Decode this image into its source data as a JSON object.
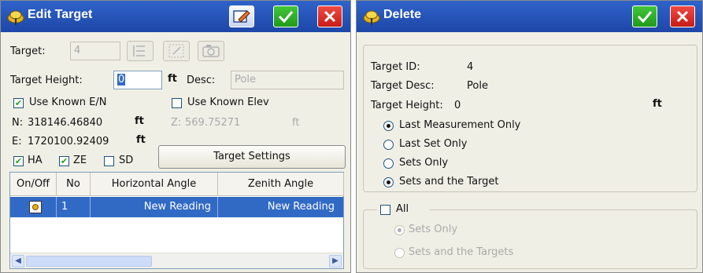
{
  "left_window": {
    "title": "Edit Target",
    "target": {
      "label": "Target:",
      "value": "4"
    },
    "target_height": {
      "label": "Target Height:",
      "value": "0",
      "unit": "ft"
    },
    "desc": {
      "label": "Desc:",
      "value": "Pole"
    },
    "use_known_en": {
      "label": "Use Known E/N",
      "checked": true
    },
    "use_known_elev": {
      "label": "Use Known Elev",
      "checked": false
    },
    "northing": {
      "label": "N:",
      "value": "318146.46840",
      "unit": "ft"
    },
    "elevation": {
      "label": "Z:",
      "value": "569.75271",
      "unit": "ft"
    },
    "easting": {
      "label": "E:",
      "value": "1720100.92409",
      "unit": "ft"
    },
    "checks": [
      {
        "label": "HA",
        "checked": true
      },
      {
        "label": "ZE",
        "checked": true
      },
      {
        "label": "SD",
        "checked": false
      }
    ],
    "target_settings_label": "Target Settings",
    "grid": {
      "columns": [
        "On/Off",
        "No",
        "Horizontal Angle",
        "Zenith Angle"
      ],
      "rows": [
        {
          "no": "1",
          "horizontal": "New Reading",
          "zenith": "New Reading"
        }
      ]
    }
  },
  "right_window": {
    "title": "Delete",
    "info": {
      "id_label": "Target ID:",
      "id_value": "4",
      "desc_label": "Target Desc:",
      "desc_value": "Pole",
      "height_label": "Target Height:",
      "height_value": "0",
      "height_unit": "ft"
    },
    "options": [
      {
        "label": "Last Measurement Only",
        "selected": true
      },
      {
        "label": "Last Set Only",
        "selected": false
      },
      {
        "label": "Sets Only",
        "selected": false
      },
      {
        "label": "Sets and the Target",
        "selected": true
      }
    ],
    "all": {
      "label": "All",
      "checked": false
    },
    "all_options": [
      {
        "label": "Sets Only",
        "selected": true
      },
      {
        "label": "Sets and the Targets",
        "selected": false
      }
    ]
  },
  "colors": {
    "title_bar": "#2f63c9",
    "ok": "#1f9a1a",
    "cancel": "#c81b15",
    "selection": "#316ac5"
  },
  "icons": [
    "app-logo-icon",
    "edit-icon",
    "ok-check-icon",
    "cancel-x-icon",
    "list-icon",
    "stake-icon",
    "camera-icon",
    "target-marker-icon"
  ]
}
